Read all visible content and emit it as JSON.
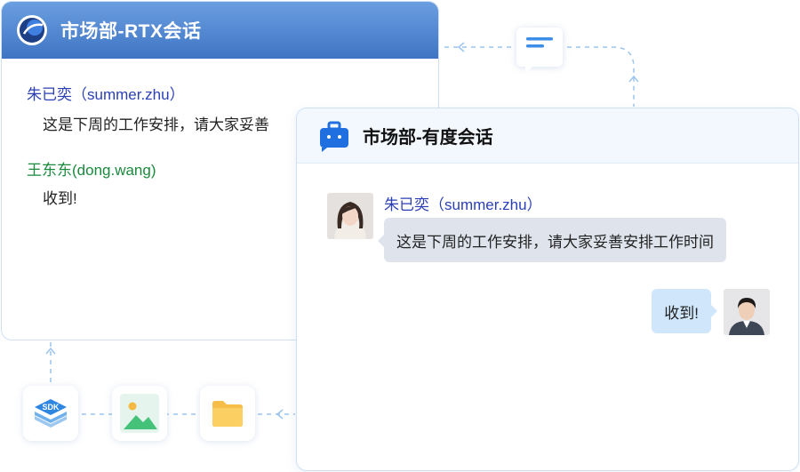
{
  "rtx_window": {
    "title": "市场部-RTX会话",
    "messages": [
      {
        "sender": "朱已奕（summer.zhu）",
        "text": "这是下周的工作安排，请大家妥善",
        "name_color": "#2a3fb5"
      },
      {
        "sender": "王东东(dong.wang)",
        "text": "收到!",
        "name_color": "#1a8a3c"
      }
    ]
  },
  "youdu_window": {
    "title": "市场部-有度会话",
    "incoming": {
      "sender": "朱已奕（summer.zhu）",
      "text": "这是下周的工作安排，请大家妥善安排工作时间"
    },
    "outgoing": {
      "text": "收到!"
    }
  },
  "integrations": {
    "sdk_label": "SDK",
    "items": [
      "sdk-icon",
      "image-icon",
      "folder-icon"
    ]
  },
  "colors": {
    "rtx_header": "#4a7fcc",
    "connector": "#9cc4ee",
    "incoming_bubble": "#dfe4ec",
    "outgoing_bubble": "#cfe6fb"
  }
}
